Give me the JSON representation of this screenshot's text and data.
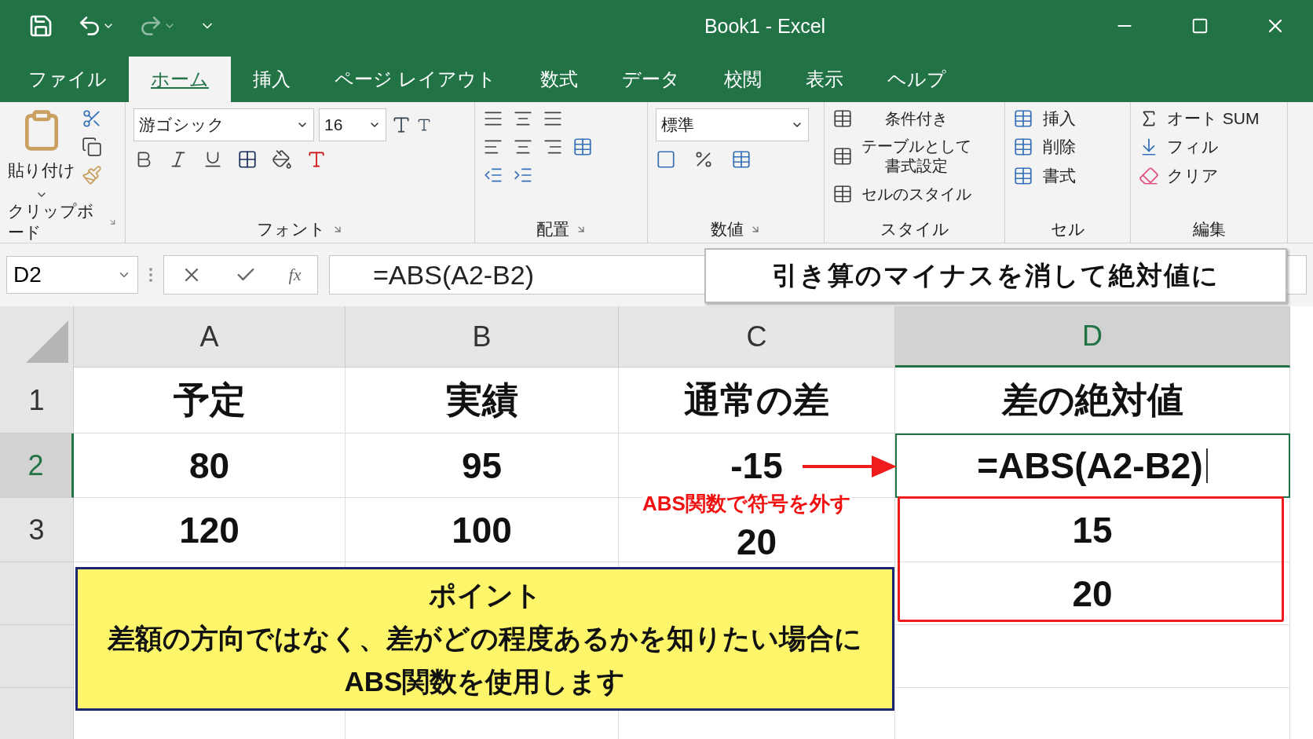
{
  "window": {
    "title": "Book1  -  Excel"
  },
  "tabs": [
    {
      "label": "ファイル",
      "selected": false
    },
    {
      "label": "ホーム",
      "selected": true
    },
    {
      "label": "挿入",
      "selected": false
    },
    {
      "label": "ページ レイアウト",
      "selected": false
    },
    {
      "label": "数式",
      "selected": false
    },
    {
      "label": "データ",
      "selected": false
    },
    {
      "label": "校閲",
      "selected": false
    },
    {
      "label": "表示",
      "selected": false
    },
    {
      "label": "ヘルプ",
      "selected": false
    }
  ],
  "ribbon": {
    "clipboard": {
      "paste": "貼り付け",
      "label": "クリップボード"
    },
    "font": {
      "font_name": "游ゴシック",
      "font_size": "16",
      "label": "フォント"
    },
    "alignment": {
      "label": "配置"
    },
    "number": {
      "format": "標準",
      "label": "数値"
    },
    "styles": {
      "items": [
        "条件付き",
        "テーブルとして書式設定",
        "セルのスタイル"
      ],
      "label": "スタイル"
    },
    "cells": {
      "items": [
        "挿入",
        "削除",
        "書式"
      ],
      "label": "セル"
    },
    "editing": {
      "items": [
        "オート SUM",
        "フィル",
        "クリア"
      ],
      "label": "編集"
    }
  },
  "formula_bar": {
    "name_box": "D2",
    "function_label": "fx",
    "formula": "=ABS(A2-B2)"
  },
  "sheet": {
    "columns": [
      {
        "label": "A",
        "selected": false
      },
      {
        "label": "B",
        "selected": false
      },
      {
        "label": "C",
        "selected": false
      },
      {
        "label": "D",
        "selected": true
      }
    ],
    "rows": [
      {
        "label": "1",
        "selected": false,
        "cells": [
          {
            "value": "予定",
            "selected": false
          },
          {
            "value": "実績",
            "selected": false
          },
          {
            "value": "通常の差",
            "selected": false
          },
          {
            "value": "差の絶対値",
            "selected": false
          }
        ]
      },
      {
        "label": "2",
        "selected": true,
        "cells": [
          {
            "value": "80",
            "selected": false
          },
          {
            "value": "95",
            "selected": false
          },
          {
            "value": "-15",
            "selected": false
          },
          {
            "value": "=ABS(A2-B2)",
            "selected": true
          }
        ]
      },
      {
        "label": "3",
        "selected": false,
        "cells": [
          {
            "value": "120",
            "selected": false
          },
          {
            "value": "100",
            "selected": false
          },
          {
            "value": "20",
            "selected": false
          },
          {
            "value": "15",
            "selected": false
          }
        ]
      },
      {
        "selected": false,
        "cells": [
          null,
          null,
          null,
          {
            "value": "20",
            "selected": false
          }
        ]
      }
    ]
  },
  "annotations": {
    "callout": "引き算のマイナスを消して絶対値に",
    "label": "ABS関数で符号を外す",
    "note": {
      "title": "ポイント",
      "lines": [
        "差額の方向ではなく、差がどの程度あるかを知りたい場合に",
        "ABS関数を使用します"
      ]
    }
  }
}
